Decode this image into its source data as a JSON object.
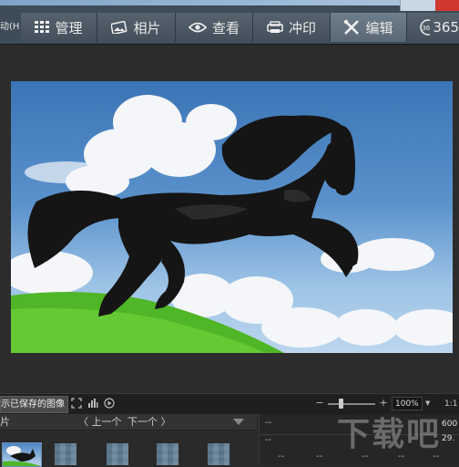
{
  "toolbar": {
    "left_stub": "动(H)",
    "tabs": [
      {
        "label": "管理",
        "icon": "grid-icon"
      },
      {
        "label": "相片",
        "icon": "photo-icon"
      },
      {
        "label": "查看",
        "icon": "eye-icon"
      },
      {
        "label": "冲印",
        "icon": "print-icon"
      },
      {
        "label": "编辑",
        "icon": "edit-tools-icon",
        "active": true
      },
      {
        "label": "365",
        "icon": "badge-365-icon"
      }
    ]
  },
  "statusbar": {
    "saved_label": "示已保存的图像",
    "zoom_minus": "−",
    "zoom_plus": "+",
    "zoom_value": "100%",
    "zoom_level": 100,
    "ratio_button": "1:1"
  },
  "filmstrip": {
    "header_left": "片",
    "prev_label": "上一个",
    "next_label": "下一个"
  },
  "info_panel": {
    "dashes": [
      "--",
      "--",
      "--",
      "--",
      "--",
      "--",
      "--"
    ],
    "right_values": [
      "600",
      "29."
    ]
  },
  "watermark": "下载吧",
  "colors": {
    "toolbar_bg": "#3e4b58",
    "active_tab": "#6f7e8c",
    "app_bg": "#2a2a2a",
    "window_close": "#d0372f"
  }
}
